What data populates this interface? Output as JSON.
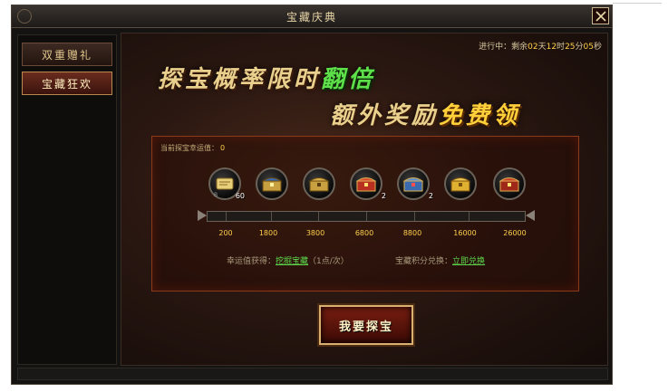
{
  "window": {
    "title": "宝藏庆典"
  },
  "tabs": [
    {
      "label": "双重赠礼",
      "active": false
    },
    {
      "label": "宝藏狂欢",
      "active": true
    }
  ],
  "countdown": {
    "prefix": "进行中：剩余",
    "days": "02",
    "days_unit": "天",
    "hours": "12",
    "hours_unit": "时",
    "minutes": "25",
    "minutes_unit": "分",
    "seconds": "05",
    "seconds_unit": "秒"
  },
  "headline": {
    "line1_text": "探宝概率限时",
    "line1_highlight": "翻倍",
    "line2_text": "额外奖励",
    "line2_highlight": "免费领"
  },
  "luck": {
    "label": "当前探宝幸运值：",
    "value": "0",
    "progress": 0
  },
  "rewards": [
    {
      "icon": "scroll-icon",
      "count": "60",
      "bound": "B"
    },
    {
      "icon": "chest-blue-icon",
      "count": ""
    },
    {
      "icon": "chest-gold-icon",
      "count": ""
    },
    {
      "icon": "chest-red-icon",
      "count": "2"
    },
    {
      "icon": "chest-blue-icon",
      "count": "2"
    },
    {
      "icon": "chest-gold-icon",
      "count": ""
    },
    {
      "icon": "chest-red-icon",
      "count": ""
    }
  ],
  "thresholds": [
    "200",
    "1800",
    "3800",
    "6800",
    "8800",
    "16000",
    "26000"
  ],
  "info": {
    "luck_gain_label": "幸运值获得：",
    "luck_gain_link": "挖掘宝藏",
    "luck_gain_rate": "（1点/次）",
    "exchange_label": "宝藏积分兑换：",
    "exchange_link": "立即兑换"
  },
  "action": {
    "label": "我要探宝"
  },
  "colors": {
    "accent_gold": "#ffcf4a",
    "accent_green": "#5ee04a",
    "link_green": "#5cd64a",
    "panel_border": "#8a3a1a"
  }
}
